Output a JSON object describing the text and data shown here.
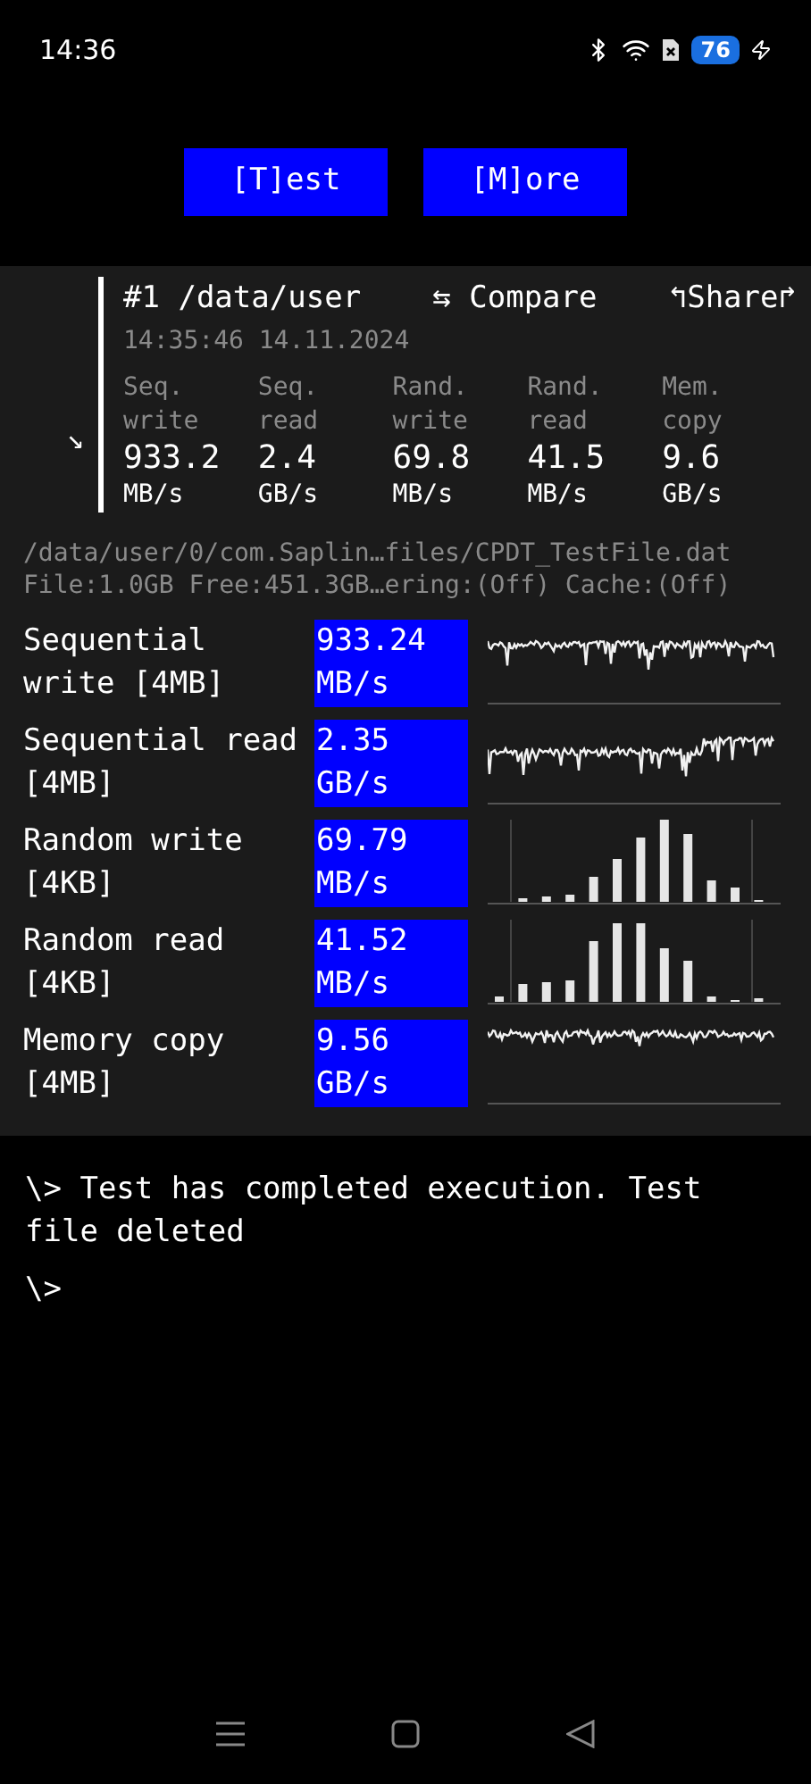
{
  "status_bar": {
    "time": "14:36",
    "battery": "76"
  },
  "buttons": [
    {
      "label": "[T]est"
    },
    {
      "label": "[M]ore"
    }
  ],
  "summary": {
    "arrow": "↘",
    "title": "#1 /data/user",
    "compare": "⇆ Compare",
    "share": "↰Share↱",
    "timestamp": "14:35:46 14.11.2024",
    "columns": [
      {
        "label": [
          "Seq.",
          "write"
        ],
        "value": "933.2",
        "unit": "MB/s"
      },
      {
        "label": [
          "Seq.",
          "read"
        ],
        "value": "2.4",
        "unit": "GB/s"
      },
      {
        "label": [
          "Rand.",
          "write"
        ],
        "value": "69.8",
        "unit": "MB/s"
      },
      {
        "label": [
          "Rand.",
          "read"
        ],
        "value": "41.5",
        "unit": "MB/s"
      },
      {
        "label": [
          "Mem.",
          "copy"
        ],
        "value": "9.6",
        "unit": "GB/s"
      }
    ]
  },
  "file_info": [
    "/data/user/0/com.Saplin…files/CPDT_TestFile.dat",
    "File:1.0GB Free:451.3GB…ering:(Off) Cache:(Off)"
  ],
  "results": [
    {
      "label": "Sequential write [4MB]",
      "value": "933.24",
      "unit": "MB/s",
      "kind": "line"
    },
    {
      "label": "Sequential read [4MB]",
      "value": "2.35",
      "unit": "GB/s",
      "kind": "line"
    },
    {
      "label": "Random write [4KB]",
      "value": "69.79",
      "unit": "MB/s",
      "kind": "histogram"
    },
    {
      "label": "Random read [4KB]",
      "value": "41.52",
      "unit": "MB/s",
      "kind": "histogram"
    },
    {
      "label": "Memory copy [4MB]",
      "value": "9.56",
      "unit": "GB/s",
      "kind": "line"
    }
  ],
  "console": [
    "\\> Test has completed execution. Test file deleted",
    "\\>"
  ]
}
